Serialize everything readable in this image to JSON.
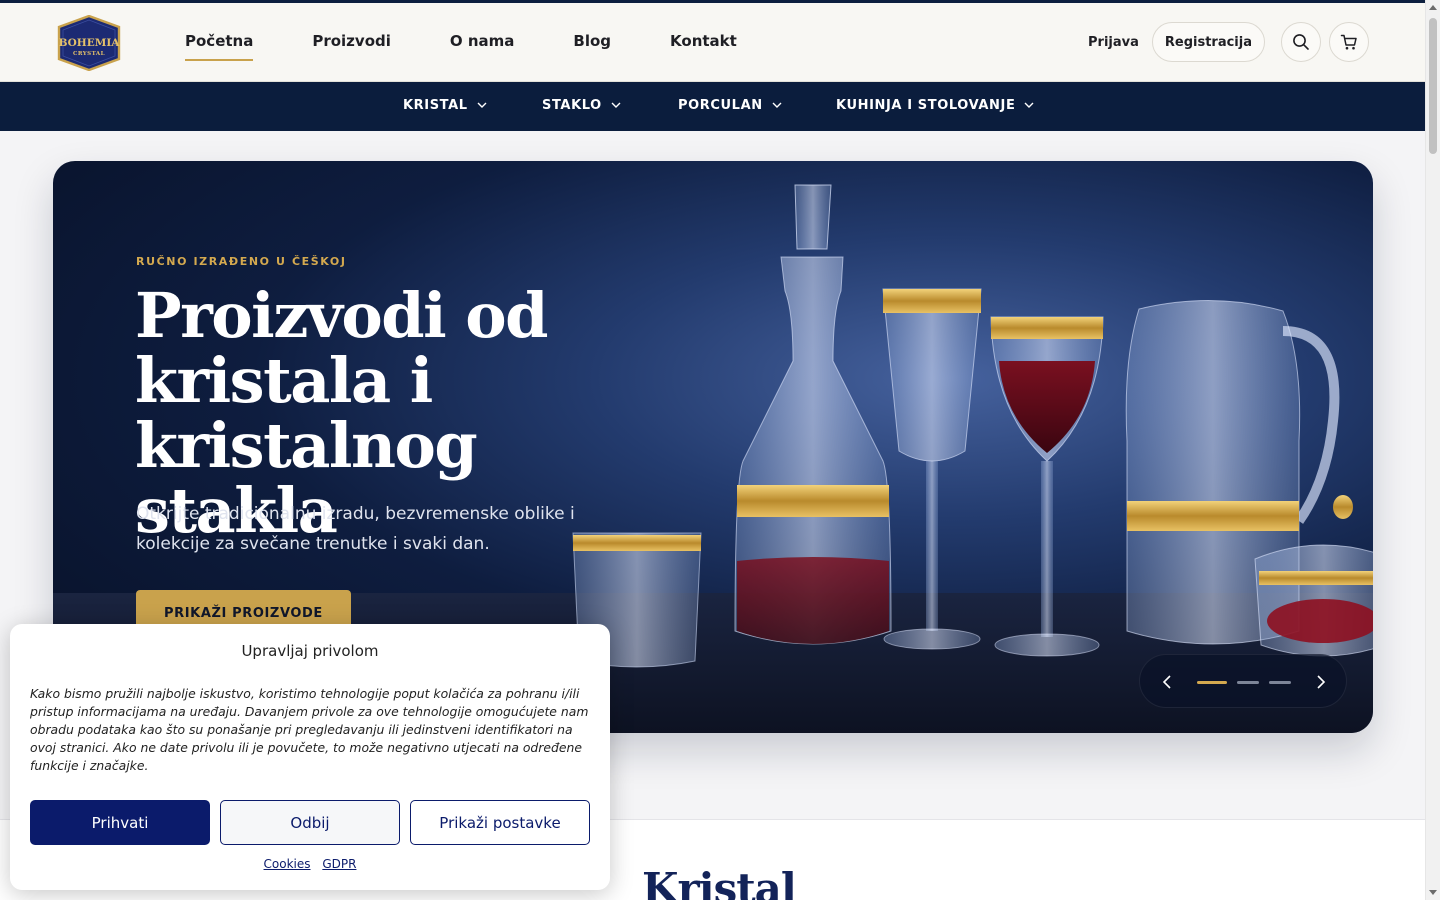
{
  "header": {
    "logo_line1": "BOHEMIA",
    "logo_line2": "CRYSTAL",
    "nav": [
      "Početna",
      "Proizvodi",
      "O nama",
      "Blog",
      "Kontakt"
    ],
    "active_nav": "Početna",
    "login": "Prijava",
    "register": "Registracija",
    "icons": [
      "search-icon",
      "cart-icon"
    ]
  },
  "categories": [
    "KRISTAL",
    "STAKLO",
    "PORCULAN",
    "KUHINJA I STOLOVANJE"
  ],
  "hero": {
    "eyebrow": "RUČNO IZRAĐENO U ČEŠKOJ",
    "headline_lines": [
      "Proizvodi od",
      "kristala i",
      "kristalnog stakla"
    ],
    "subtitle": "Otkrijte tradicionalnu izradu, bezvremenske oblike i kolekcije za svečane trenutke i svaki dan.",
    "cta": "PRIKAŽI PROIZVODE",
    "slides_total": 3,
    "active_slide": 1
  },
  "section": {
    "title": "Kristal"
  },
  "consent": {
    "title": "Upravljaj privolom",
    "text": "Kako bismo pružili najbolje iskustvo, koristimo tehnologije poput kolačića za pohranu i/ili pristup informacijama na uređaju. Davanjem privole za ove tehnologije omogućujete nam obradu podataka kao što su ponašanje pri pregledavanju ili jedinstveni identifikatori na ovoj stranici. Ako ne date privolu ili je povučete, to može negativno utjecati na određene funkcije i značajke.",
    "accept": "Prihvati",
    "deny": "Odbij",
    "preferences": "Prikaži postavke",
    "links": [
      "Cookies",
      "GDPR"
    ]
  },
  "colors": {
    "navy": "#0b1d3d",
    "gold": "#c9a24c",
    "consent_blue": "#0b1b6b"
  }
}
